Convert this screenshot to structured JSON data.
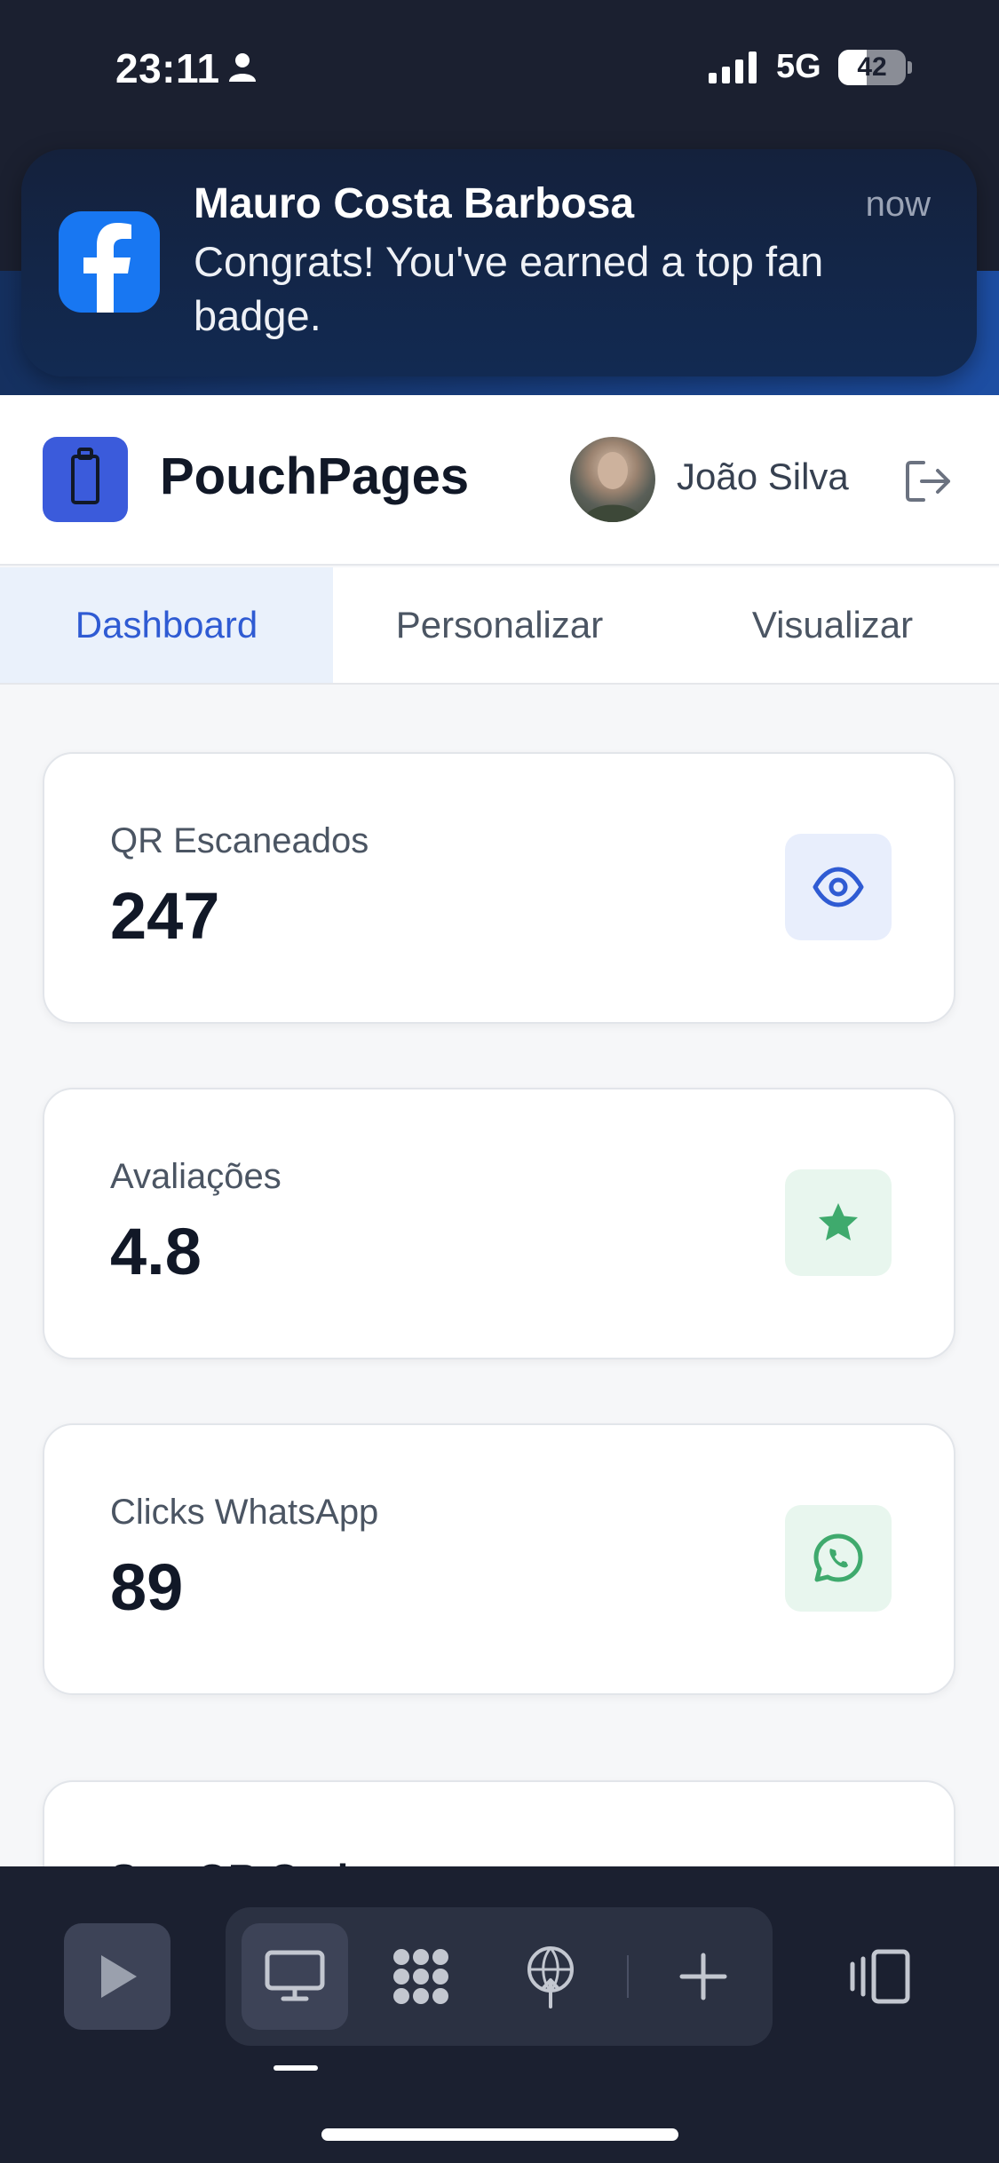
{
  "status_bar": {
    "time": "23:11",
    "network": "5G",
    "battery": "42",
    "battery_level": 0.42
  },
  "notification": {
    "app_icon": "facebook-icon",
    "title": "Mauro Costa Barbosa",
    "time": "now",
    "body": "Congrats! You've earned a top fan badge."
  },
  "header": {
    "brand_name": "PouchPages",
    "brand_icon": "pouch-icon",
    "user_name": "João Silva",
    "logout_icon": "logout-icon"
  },
  "tabs": [
    {
      "label": "Dashboard",
      "active": true
    },
    {
      "label": "Personalizar",
      "active": false
    },
    {
      "label": "Visualizar",
      "active": false
    }
  ],
  "stats": [
    {
      "label": "QR Escaneados",
      "value": "247",
      "icon": "eye-icon",
      "color": "#2f5bd3"
    },
    {
      "label": "Avaliações",
      "value": "4.8",
      "icon": "star-icon",
      "color": "#3faa6d"
    },
    {
      "label": "Clicks WhatsApp",
      "value": "89",
      "icon": "whatsapp-icon",
      "color": "#3faa6d"
    }
  ],
  "next_card_partial": {
    "title": "Seu QR Code"
  },
  "toolbar": {
    "items": [
      "play-icon",
      "desktop-icon",
      "apps-icon",
      "broadcast-icon",
      "plus-icon",
      "multitask-icon"
    ],
    "selected": "desktop-icon"
  },
  "colors": {
    "accent": "#2f5bd3",
    "dark_bg": "#1b2030",
    "facebook_blue": "#1877f2"
  }
}
